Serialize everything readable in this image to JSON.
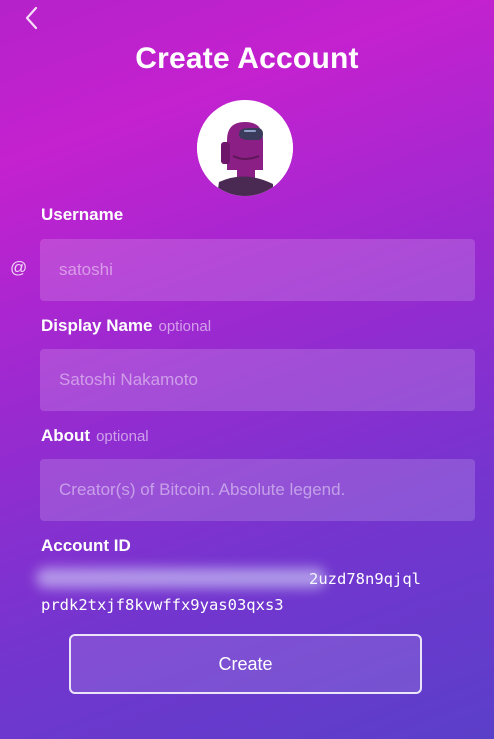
{
  "header": {
    "back_icon": "chevron-left-icon",
    "title": "Create Account"
  },
  "avatar": {
    "icon": "crewmate-avatar"
  },
  "username": {
    "label": "Username",
    "prefix": "@",
    "placeholder": "satoshi",
    "value": ""
  },
  "display_name": {
    "label": "Display Name",
    "optional_tag": "optional",
    "placeholder": "Satoshi Nakamoto",
    "value": ""
  },
  "about": {
    "label": "About",
    "optional_tag": "optional",
    "placeholder": "Creator(s) of Bitcoin. Absolute legend.",
    "value": ""
  },
  "account": {
    "label": "Account ID",
    "id_visible_part": "2uzd78n9qjql",
    "id_line2": "prdk2txjf8kvwffx9yas03qxs3"
  },
  "actions": {
    "create_label": "Create"
  },
  "colors": {
    "gradient_top": "#c421cf",
    "gradient_bottom": "#5a3fc9",
    "text": "#ffffff"
  }
}
